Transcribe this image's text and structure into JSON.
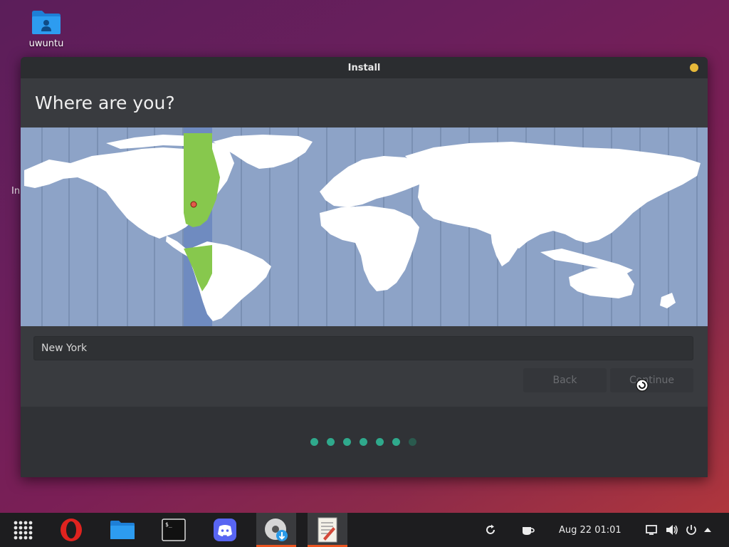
{
  "desktop": {
    "home_folder_label": "uwuntu",
    "side_fragment": "In"
  },
  "window": {
    "title": "Install",
    "heading": "Where are you?",
    "city_value": "New York",
    "back_label": "Back",
    "continue_label": "Continue",
    "progress": {
      "total_steps": 7,
      "completed_steps": 6
    }
  },
  "taskbar": {
    "apps": [
      {
        "name": "app-grid-icon"
      },
      {
        "name": "opera-icon"
      },
      {
        "name": "files-icon"
      },
      {
        "name": "terminal-icon"
      },
      {
        "name": "discord-icon"
      },
      {
        "name": "installer-icon",
        "active": true
      },
      {
        "name": "text-editor-icon",
        "active": true
      }
    ],
    "clock": "Aug 22  01:01",
    "tray_icons": [
      "refresh-icon",
      "caffeine-icon",
      "display-icon",
      "volume-icon",
      "power-icon",
      "menu-arrow-icon"
    ]
  },
  "colors": {
    "accent": "#e95420",
    "progress_active": "#2fa98c",
    "map_ocean": "#8da3c7",
    "map_selected_zone": "#87c84d"
  }
}
